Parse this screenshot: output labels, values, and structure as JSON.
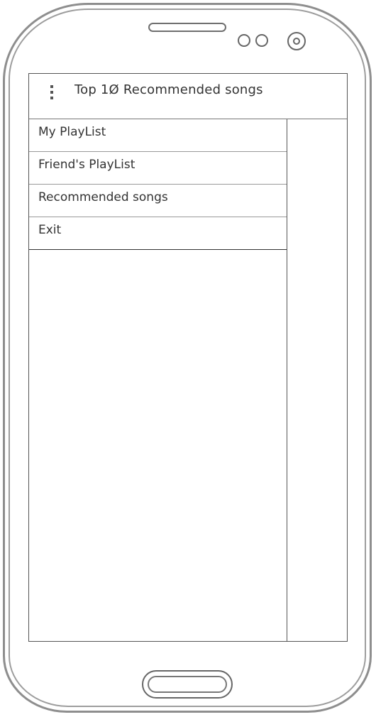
{
  "app_bar": {
    "title": "Top 1Ø Recommended songs"
  },
  "drawer": {
    "items": [
      {
        "label": "My PlayList"
      },
      {
        "label": "Friend's PlayList"
      },
      {
        "label": "Recommended songs"
      },
      {
        "label": "Exit"
      }
    ]
  }
}
